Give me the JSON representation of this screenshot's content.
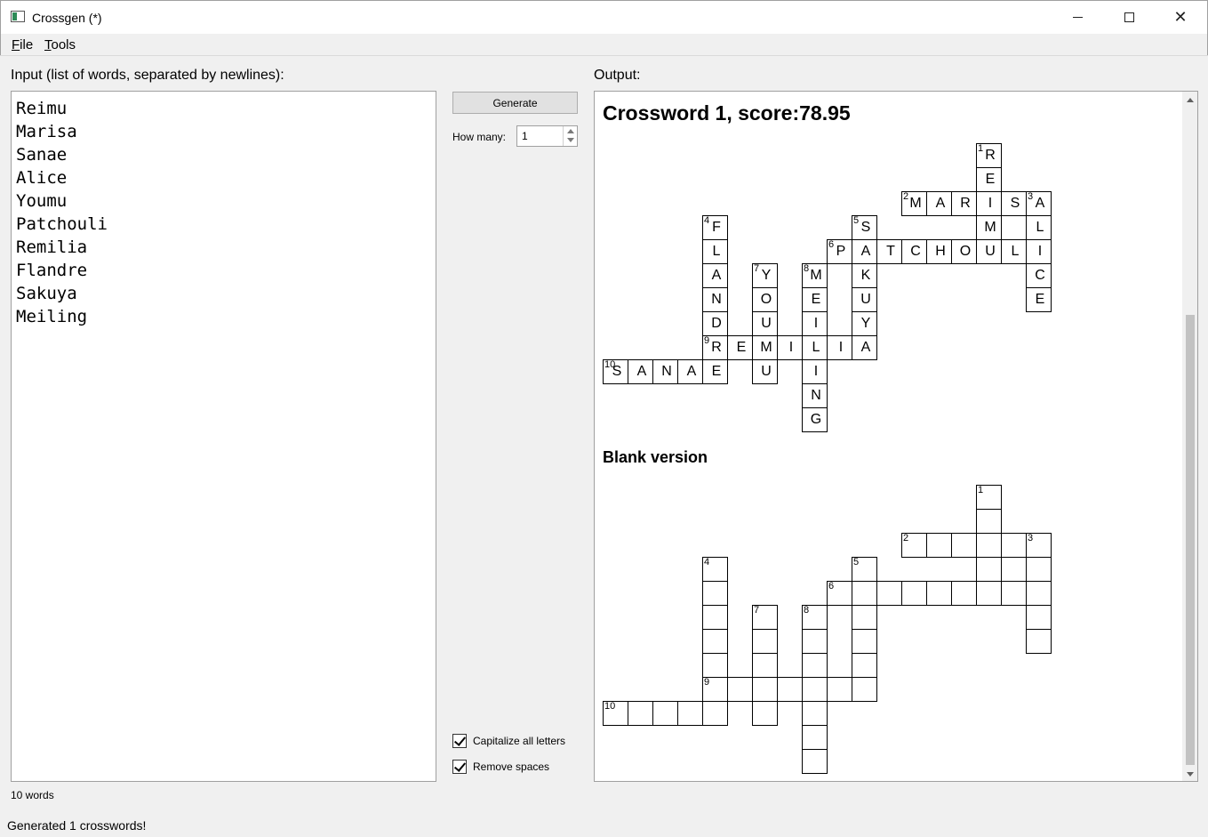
{
  "window": {
    "title": "Crossgen (*)",
    "minimize_label": "—",
    "maximize_label": "□",
    "close_label": "✕"
  },
  "menu": {
    "file": "File",
    "tools": "Tools"
  },
  "input": {
    "label": "Input (list of words, separated by newlines):",
    "words": [
      "Reimu",
      "Marisa",
      "Sanae",
      "Alice",
      "Youmu",
      "Patchouli",
      "Remilia",
      "Flandre",
      "Sakuya",
      "Meiling"
    ]
  },
  "controls": {
    "generate_label": "Generate",
    "how_many_label": "How many:",
    "how_many_value": "1",
    "capitalize_label": "Capitalize all letters",
    "capitalize_checked": true,
    "remove_spaces_label": "Remove spaces",
    "remove_spaces_checked": true
  },
  "output": {
    "label": "Output:",
    "crossword_title": "Crossword 1, score:78.95",
    "blank_title": "Blank version",
    "words": [
      {
        "num": 1,
        "word": "REIMU",
        "dir": "down",
        "row": 0,
        "col": 15
      },
      {
        "num": 2,
        "word": "MARISA",
        "dir": "across",
        "row": 2,
        "col": 12
      },
      {
        "num": 3,
        "word": "ALICE",
        "dir": "down",
        "row": 2,
        "col": 17
      },
      {
        "num": 4,
        "word": "FLANDRE",
        "dir": "down",
        "row": 3,
        "col": 4
      },
      {
        "num": 5,
        "word": "SAKUYA",
        "dir": "down",
        "row": 3,
        "col": 10
      },
      {
        "num": 6,
        "word": "PATCHOULI",
        "dir": "across",
        "row": 4,
        "col": 9
      },
      {
        "num": 7,
        "word": "YOUMU",
        "dir": "down",
        "row": 5,
        "col": 6
      },
      {
        "num": 8,
        "word": "MEILING",
        "dir": "down",
        "row": 5,
        "col": 8
      },
      {
        "num": 9,
        "word": "REMILIA",
        "dir": "across",
        "row": 8,
        "col": 4
      },
      {
        "num": 10,
        "word": "SANAE",
        "dir": "across",
        "row": 9,
        "col": 0
      }
    ]
  },
  "status": {
    "word_count": "10 words",
    "message": "Generated 1 crosswords!"
  }
}
